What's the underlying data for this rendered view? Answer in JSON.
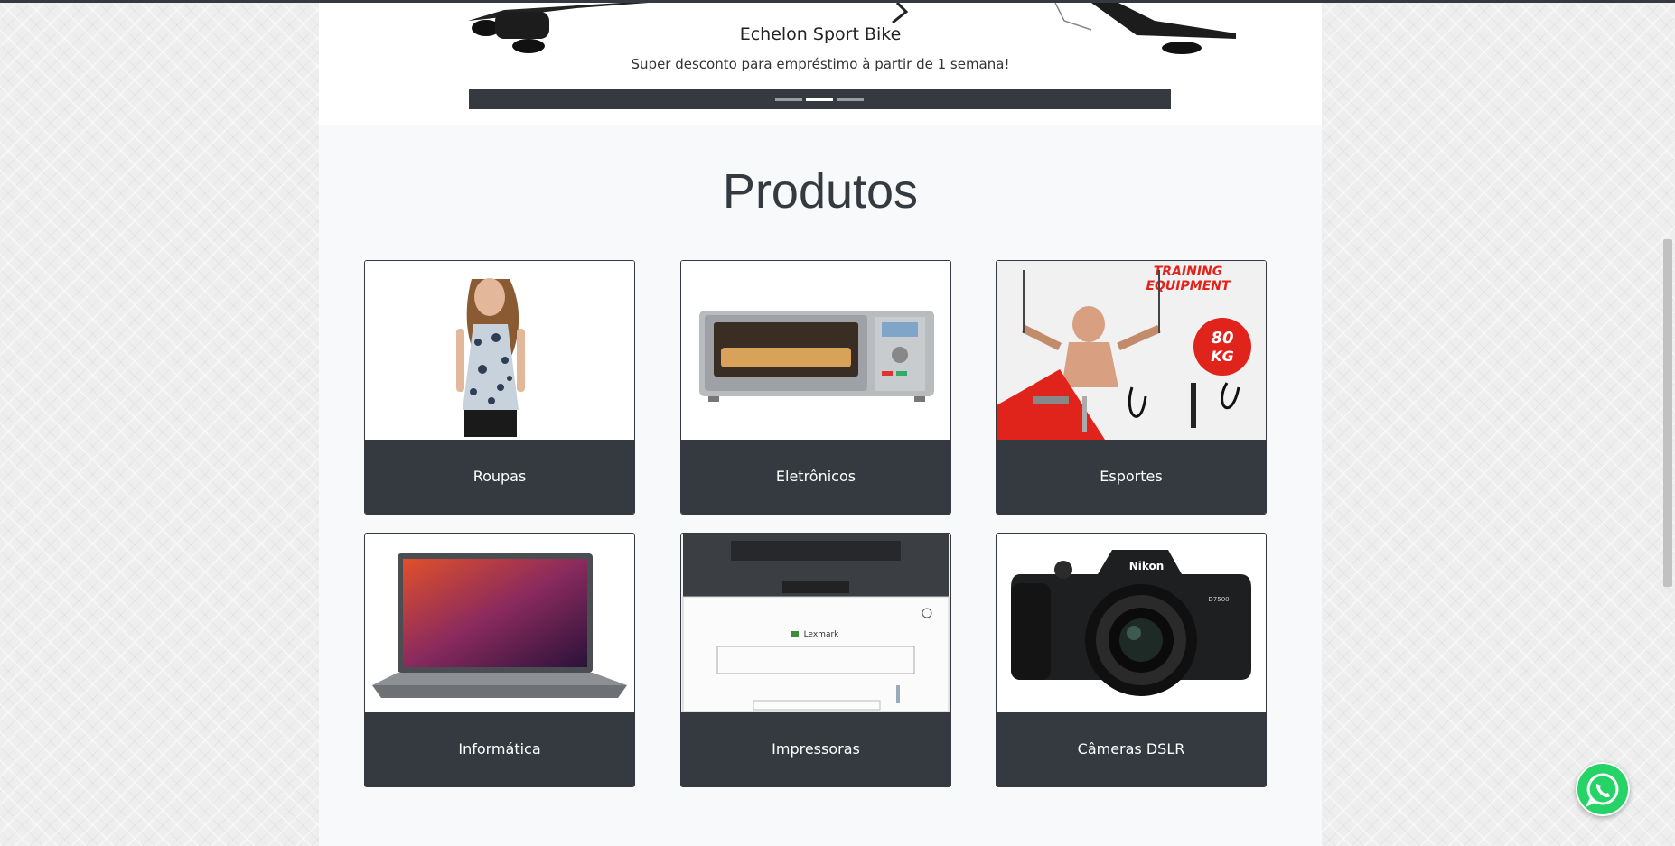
{
  "carousel": {
    "title": "Echelon Sport Bike",
    "subtitle": "Super desconto para empréstimo à partir de 1 semana!",
    "indicators": 3,
    "active_indicator": 1
  },
  "products": {
    "title": "Produtos",
    "items": [
      {
        "label": "Roupas"
      },
      {
        "label": "Eletrônicos"
      },
      {
        "label": "Esportes",
        "image_text": [
          "TRAINING",
          "EQUIPMENT",
          "80",
          "KG"
        ]
      },
      {
        "label": "Informática"
      },
      {
        "label": "Impressoras",
        "image_text": [
          "Lexmark"
        ]
      },
      {
        "label": "Câmeras DSLR",
        "image_text": [
          "Nikon",
          "D7500"
        ]
      }
    ]
  },
  "colors": {
    "dark": "#343a40",
    "whatsapp": "#25d366",
    "training_red": "#e0241b"
  },
  "icons": {
    "whatsapp": "whatsapp-icon"
  }
}
